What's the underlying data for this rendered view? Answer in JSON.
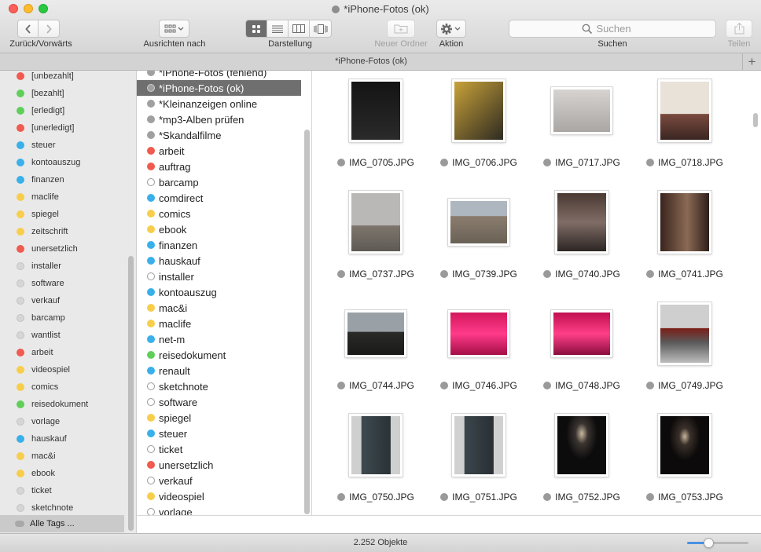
{
  "window": {
    "title": "*iPhone-Fotos (ok)"
  },
  "toolbar": {
    "nav_label": "Zurück/Vorwärts",
    "arrange_label": "Ausrichten nach",
    "view_label": "Darstellung",
    "new_folder_label": "Neuer Ordner",
    "action_label": "Aktion",
    "search_label": "Suchen",
    "search_placeholder": "Suchen",
    "share_label": "Teilen"
  },
  "tabbar": {
    "title": "*iPhone-Fotos (ok)"
  },
  "sidebar": {
    "items": [
      {
        "label": "[unbezahlt]",
        "color": "#f05a4f"
      },
      {
        "label": "[bezahlt]",
        "color": "#5fcf59"
      },
      {
        "label": "[erledigt]",
        "color": "#5fcf59"
      },
      {
        "label": "[unerledigt]",
        "color": "#f05a4f"
      },
      {
        "label": "steuer",
        "color": "#3ab0ea"
      },
      {
        "label": "kontoauszug",
        "color": "#3ab0ea"
      },
      {
        "label": "finanzen",
        "color": "#3ab0ea"
      },
      {
        "label": "maclife",
        "color": "#f8cd4b"
      },
      {
        "label": "spiegel",
        "color": "#f8cd4b"
      },
      {
        "label": "zeitschrift",
        "color": "#f8cd4b"
      },
      {
        "label": "unersetzlich",
        "color": "#f05a4f"
      },
      {
        "label": "installer",
        "color": "#d6d6d6"
      },
      {
        "label": "software",
        "color": "#d6d6d6"
      },
      {
        "label": "verkauf",
        "color": "#d6d6d6"
      },
      {
        "label": "barcamp",
        "color": "#d6d6d6"
      },
      {
        "label": "wantlist",
        "color": "#d6d6d6"
      },
      {
        "label": "arbeit",
        "color": "#f05a4f"
      },
      {
        "label": "videospiel",
        "color": "#f8cd4b"
      },
      {
        "label": "comics",
        "color": "#f8cd4b"
      },
      {
        "label": "reisedokument",
        "color": "#5fcf59"
      },
      {
        "label": "vorlage",
        "color": "#d6d6d6"
      },
      {
        "label": "hauskauf",
        "color": "#3ab0ea"
      },
      {
        "label": "mac&i",
        "color": "#f8cd4b"
      },
      {
        "label": "ebook",
        "color": "#f8cd4b"
      },
      {
        "label": "ticket",
        "color": "#d6d6d6"
      },
      {
        "label": "sketchnote",
        "color": "#d6d6d6"
      },
      {
        "label": "Alle Tags ...",
        "color": "#a8a8a8"
      }
    ]
  },
  "taglist": {
    "items": [
      {
        "label": "*iPhone-Fotos (fehlend)",
        "color": "#a0a0a0"
      },
      {
        "label": "*iPhone-Fotos (ok)",
        "color": "#a0a0a0"
      },
      {
        "label": "*Kleinanzeigen online",
        "color": "#a0a0a0"
      },
      {
        "label": "*mp3-Alben prüfen",
        "color": "#a0a0a0"
      },
      {
        "label": "*Skandalfilme",
        "color": "#a0a0a0"
      },
      {
        "label": "arbeit",
        "color": "#f05a4f"
      },
      {
        "label": "auftrag",
        "color": "#f05a4f"
      },
      {
        "label": "barcamp",
        "color": "none"
      },
      {
        "label": "comdirect",
        "color": "#3ab0ea"
      },
      {
        "label": "comics",
        "color": "#f8cd4b"
      },
      {
        "label": "ebook",
        "color": "#f8cd4b"
      },
      {
        "label": "finanzen",
        "color": "#3ab0ea"
      },
      {
        "label": "hauskauf",
        "color": "#3ab0ea"
      },
      {
        "label": "installer",
        "color": "none"
      },
      {
        "label": "kontoauszug",
        "color": "#3ab0ea"
      },
      {
        "label": "mac&i",
        "color": "#f8cd4b"
      },
      {
        "label": "maclife",
        "color": "#f8cd4b"
      },
      {
        "label": "net-m",
        "color": "#3ab0ea"
      },
      {
        "label": "reisedokument",
        "color": "#5fcf59"
      },
      {
        "label": "renault",
        "color": "#3ab0ea"
      },
      {
        "label": "sketchnote",
        "color": "none"
      },
      {
        "label": "software",
        "color": "none"
      },
      {
        "label": "spiegel",
        "color": "#f8cd4b"
      },
      {
        "label": "steuer",
        "color": "#3ab0ea"
      },
      {
        "label": "ticket",
        "color": "none"
      },
      {
        "label": "unersetzlich",
        "color": "#f05a4f"
      },
      {
        "label": "verkauf",
        "color": "none"
      },
      {
        "label": "videospiel",
        "color": "#f8cd4b"
      },
      {
        "label": "vorlage",
        "color": "none"
      }
    ]
  },
  "files": [
    {
      "name": "IMG_0705.JPG",
      "orientation": "portrait",
      "bg": "linear-gradient(#141414,#2a2a2a)"
    },
    {
      "name": "IMG_0706.JPG",
      "orientation": "portrait",
      "bg": "linear-gradient(135deg,#c8a13a,#6b5a2a 60%,#2e2b22)"
    },
    {
      "name": "IMG_0717.JPG",
      "orientation": "landscape",
      "bg": "linear-gradient(#d6d3d0,#aaa6a4)"
    },
    {
      "name": "IMG_0718.JPG",
      "orientation": "portrait",
      "bg": "linear-gradient(#e9e2d9 55%,#7a4a3e 56%,#3a2622)"
    },
    {
      "name": "IMG_0737.JPG",
      "orientation": "portrait",
      "bg": "linear-gradient(#b9b8b6 55%,#7d766d 56%,#5e5a53)"
    },
    {
      "name": "IMG_0739.JPG",
      "orientation": "landscape",
      "bg": "linear-gradient(#aeb7bf 35%,#8a7d6e 36%,#6a6156)"
    },
    {
      "name": "IMG_0740.JPG",
      "orientation": "portrait",
      "bg": "linear-gradient(#4a3a32,#806c66 50%,#2c2624)"
    },
    {
      "name": "IMG_0741.JPG",
      "orientation": "portrait",
      "bg": "linear-gradient(90deg,#3a241d,#8a6a55 55%,#2e1f1a)"
    },
    {
      "name": "IMG_0744.JPG",
      "orientation": "landscape",
      "bg": "linear-gradient(#9aa1a6 45%,#2a2a28 46%,#1a1a18)"
    },
    {
      "name": "IMG_0746.JPG",
      "orientation": "landscape",
      "bg": "linear-gradient(#d3185c,#ff3a8a 50%,#a40f46)"
    },
    {
      "name": "IMG_0748.JPG",
      "orientation": "landscape",
      "bg": "linear-gradient(#c01050,#ff3f88 50%,#8a0e3e)"
    },
    {
      "name": "IMG_0749.JPG",
      "orientation": "portrait",
      "bg": "linear-gradient(#cfcfcf 40%,#7a1f18 41%,#5a5a5a 65%,#bdbdbd)"
    },
    {
      "name": "IMG_0750.JPG",
      "orientation": "portrait",
      "bg": "linear-gradient(90deg,#cfcfcf 20%,#3d4a50 21%,#2a3236 80%,#cfcfcf 81%)"
    },
    {
      "name": "IMG_0751.JPG",
      "orientation": "portrait",
      "bg": "linear-gradient(90deg,#d0d0d0 20%,#3a464c 21%,#2a3034 80%,#d0d0d0 81%)"
    },
    {
      "name": "IMG_0752.JPG",
      "orientation": "portrait",
      "bg": "radial-gradient(ellipse at 50% 30%,#c9b8a0 0%,#3a3430 18%,#0d0c0c 45%)"
    },
    {
      "name": "IMG_0753.JPG",
      "orientation": "portrait",
      "bg": "radial-gradient(ellipse at 50% 35%,#c8b49c 0%,#3a302a 16%,#0c0a0a 45%)"
    }
  ],
  "status": {
    "count_text": "2.252 Objekte",
    "zoom_level": 0.35
  }
}
